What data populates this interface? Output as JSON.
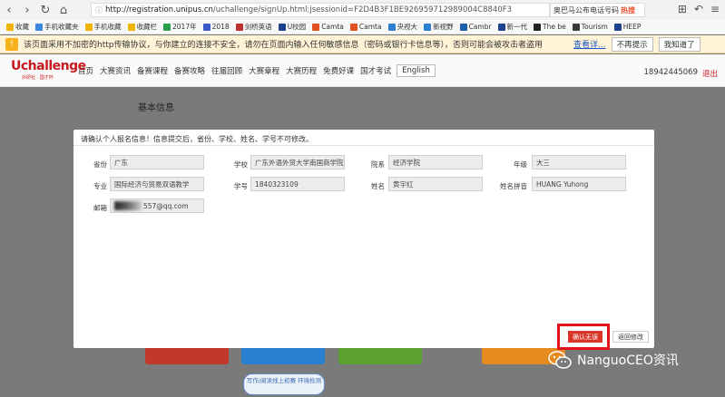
{
  "browser": {
    "url_host": "http://registration.unipus.cn",
    "url_path": "/uchallenge/signUp.html;jsessionid=F2D4B3F1BE926959712989004C8840F3",
    "search_text": "奥巴马公布电话号码",
    "search_tag": "热搜"
  },
  "bookmarks": [
    {
      "label": "收藏",
      "color": "#f0b400"
    },
    {
      "label": "手机收藏夹",
      "color": "#3a86e0"
    },
    {
      "label": "手机收藏",
      "color": "#f0b400"
    },
    {
      "label": "收藏栏",
      "color": "#f0b400"
    },
    {
      "label": "2017年",
      "color": "#2a9d4a"
    },
    {
      "label": "2018",
      "color": "#3a58c8"
    },
    {
      "label": "剑桥英语",
      "color": "#c03030"
    },
    {
      "label": "U校园",
      "color": "#1f3f8f"
    },
    {
      "label": "Camta",
      "color": "#e05020"
    },
    {
      "label": "Camta",
      "color": "#e05020"
    },
    {
      "label": "央视大",
      "color": "#2a7fd0"
    },
    {
      "label": "新视野",
      "color": "#2a7fd0"
    },
    {
      "label": "Cambr",
      "color": "#1f5fa8"
    },
    {
      "label": "新一代",
      "color": "#1f3f8f"
    },
    {
      "label": "The be",
      "color": "#222"
    },
    {
      "label": "Tourism",
      "color": "#3a3a3a"
    },
    {
      "label": "HEEP",
      "color": "#1f3f8f"
    }
  ],
  "warning": {
    "text": "该页面采用不加密的http传输协议，与你建立的连接不安全，请勿在页面内输入任何敏感信息（密码或银行卡信息等），否则可能会被攻击者盗用",
    "link": "查看详...",
    "dismiss": "不再提示",
    "ack": "我知道了"
  },
  "site": {
    "logo": "Uchallenge",
    "logo_sub": "外研社 · 国才杯",
    "nav": [
      "首页",
      "大赛资讯",
      "备赛课程",
      "备赛攻略",
      "往届回顾",
      "大赛章程",
      "大赛历程",
      "免费好课",
      "国才考试"
    ],
    "lang": "English",
    "phone": "18942445069",
    "logout": "退出"
  },
  "section_title": "基本信息",
  "modal": {
    "notice": "请确认个人报名信息！信息提交后，省份、学校、姓名、学号不可修改。",
    "fields": {
      "province": {
        "label": "省份",
        "value": "广东"
      },
      "school": {
        "label": "学校",
        "value": "广东外语外贸大学南国商学院"
      },
      "college": {
        "label": "院系",
        "value": "经济学院"
      },
      "grade": {
        "label": "年级",
        "value": "大三"
      },
      "major": {
        "label": "专业",
        "value": "国际经济与贸易双语教学"
      },
      "student_id": {
        "label": "学号",
        "value": "1840323109"
      },
      "name": {
        "label": "姓名",
        "value": "黄宇红"
      },
      "pinyin": {
        "label": "姓名拼音",
        "value": "HUANG Yuhong"
      },
      "email": {
        "label": "邮箱",
        "value": "557@qq.com"
      }
    },
    "confirm": "确认无误",
    "back": "返回修改"
  },
  "background_link": "写作/阅读线上初赛 环境检测",
  "watermark": "NanguoCEO资讯"
}
